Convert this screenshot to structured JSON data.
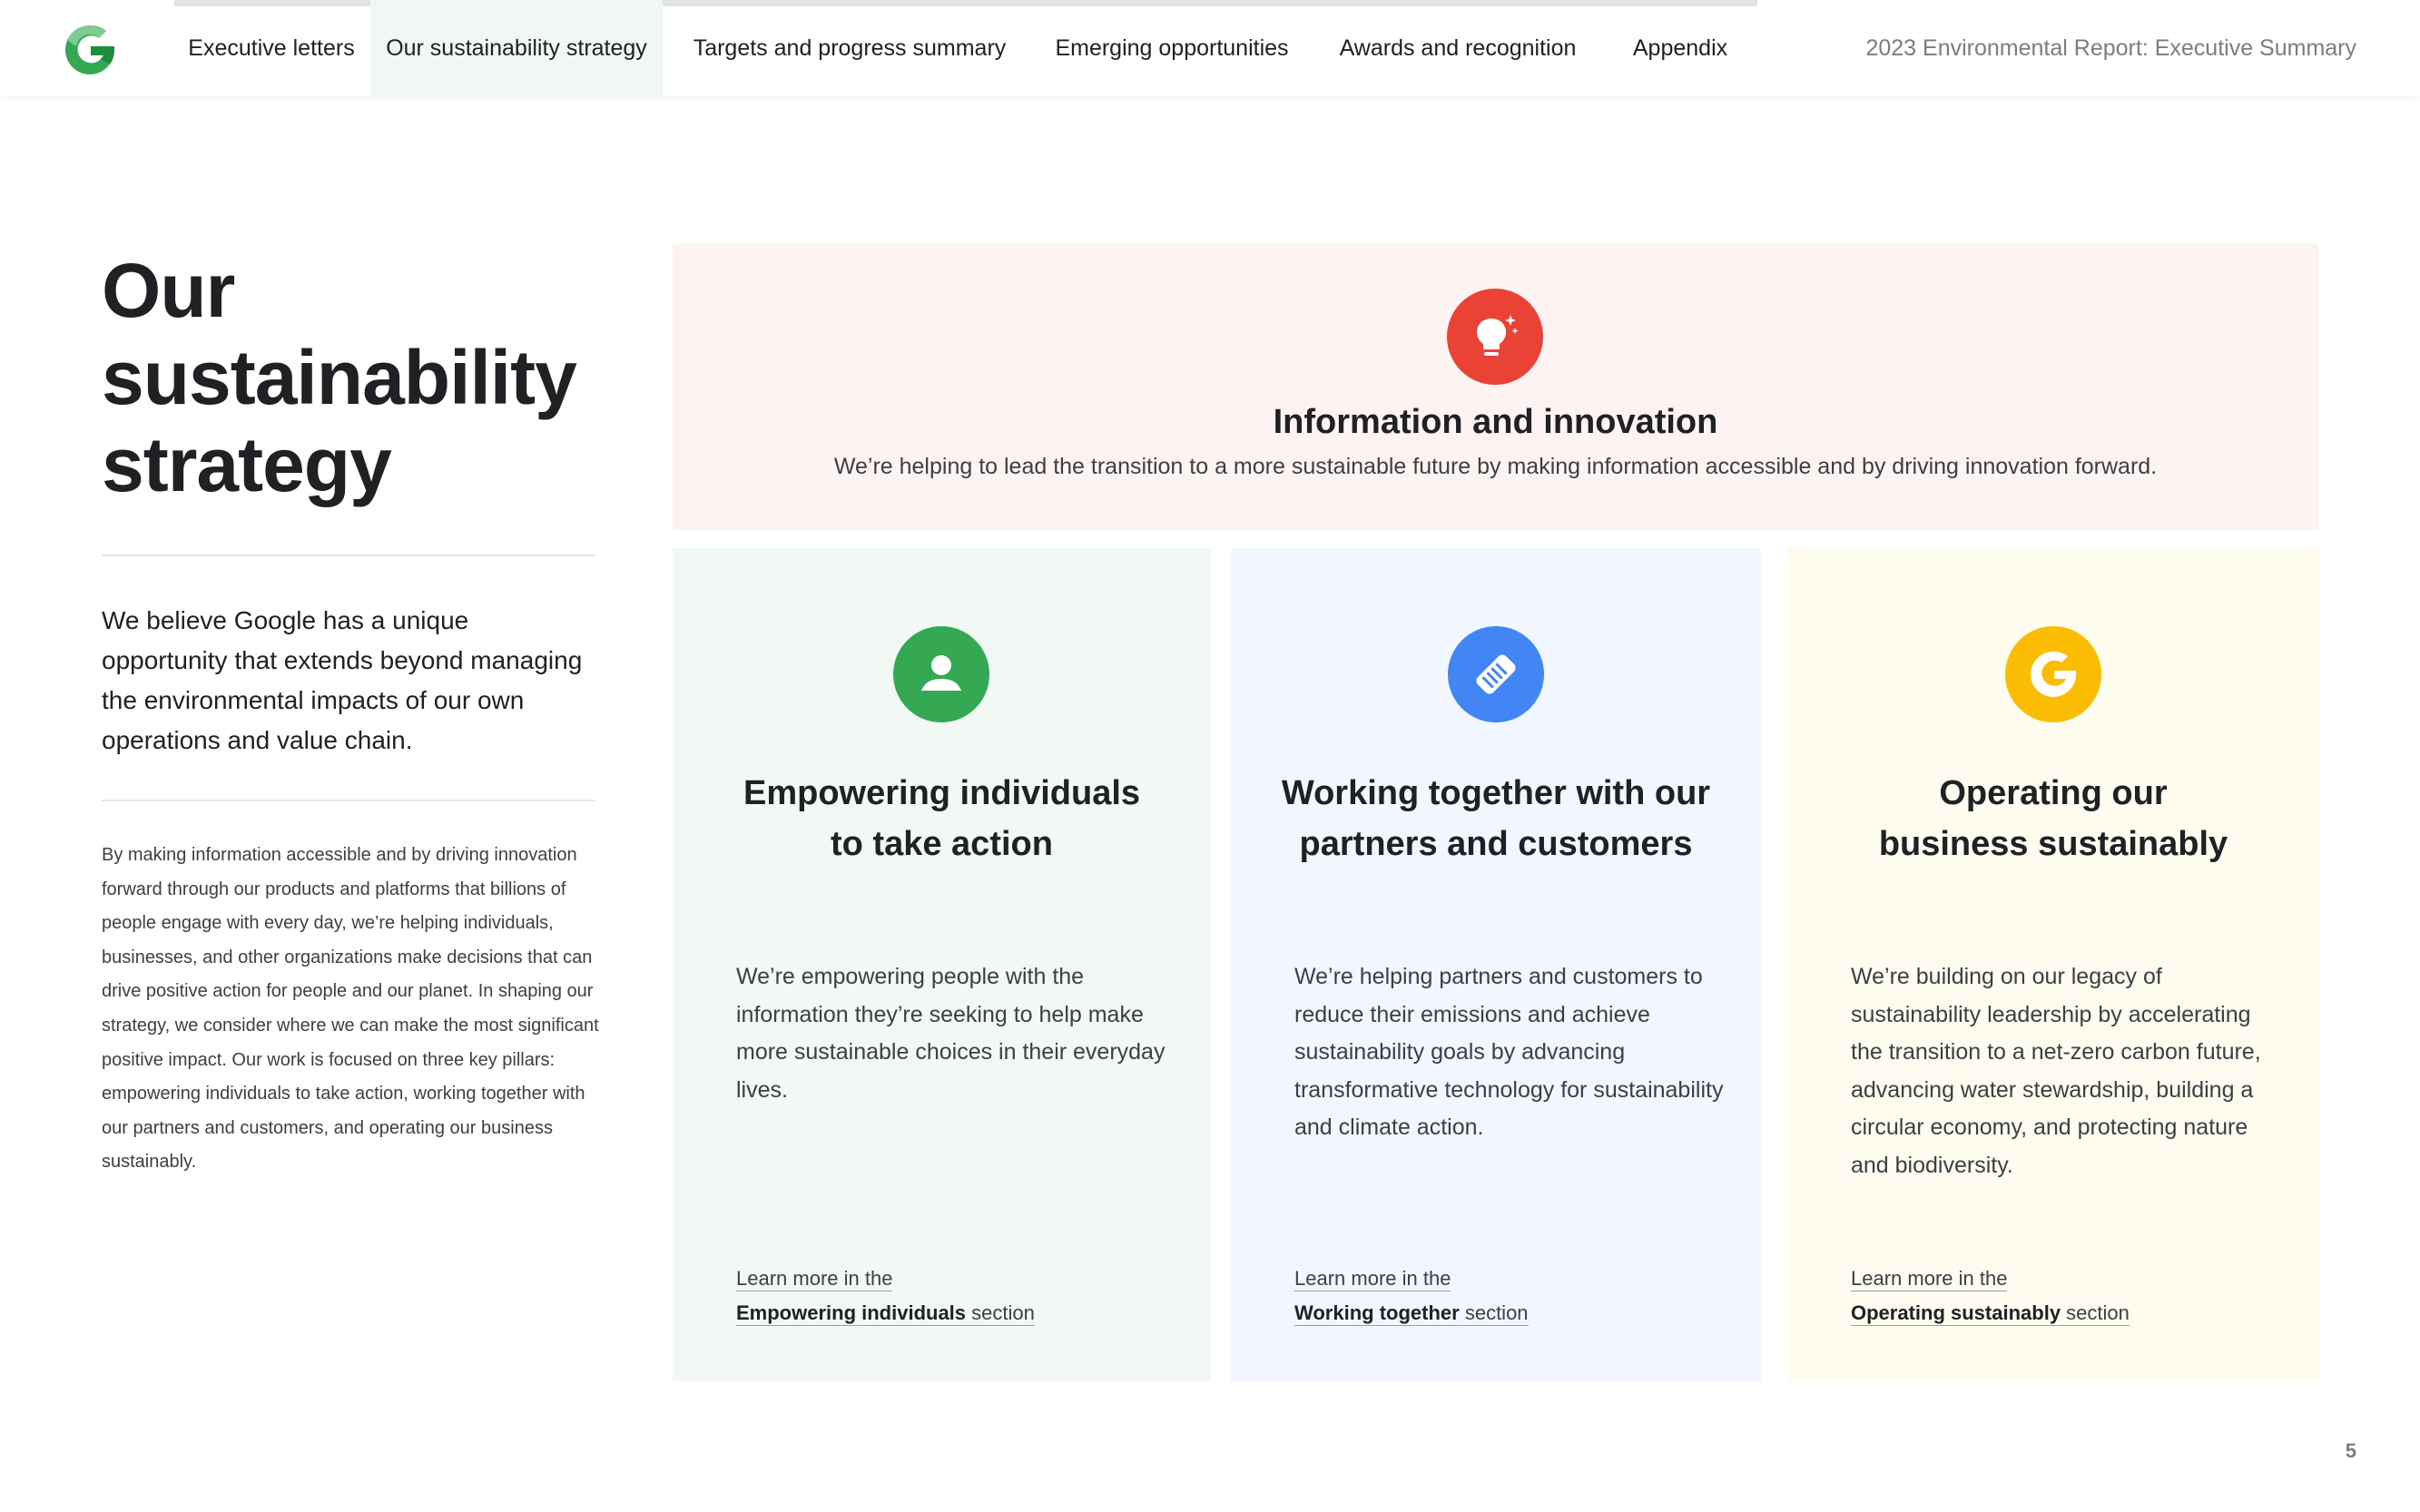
{
  "header": {
    "nav": [
      {
        "label": "Executive letters"
      },
      {
        "label": "Our sustainability strategy"
      },
      {
        "label": "Targets and progress summary"
      },
      {
        "label": "Emerging opportunities"
      },
      {
        "label": "Awards and recognition"
      },
      {
        "label": "Appendix"
      }
    ],
    "doc_title": "2023 Environmental Report: Executive Summary"
  },
  "colors": {
    "green": "#34a853",
    "red": "#ea4335",
    "blue": "#4285f4",
    "yellow": "#fbbc04"
  },
  "left": {
    "title": "Our sustainability strategy",
    "lede": "We believe Google has a unique opportunity that extends beyond managing the environmental impacts of our own operations and value chain.",
    "body": "By making information accessible and by driving innovation forward through our products and platforms that billions of people engage with every day, we’re helping individuals, businesses, and other organizations make decisions that can drive positive action for people and our planet. In shaping our strategy, we consider where we can make the most significant positive impact. Our work is focused on three key pillars: empowering individuals to take action, working together with our partners and customers, and operating our business sustainably."
  },
  "top_card": {
    "icon": "lightbulb-icon",
    "heading": "Information and innovation",
    "description": "We’re helping to lead the transition to a more sustainable future by making information accessible and by driving innovation forward."
  },
  "pillars": [
    {
      "icon": "person-icon",
      "heading_line1": "Empowering individuals",
      "heading_line2": "to take action",
      "description": "We’re empowering people with the information they’re seeking to help make more sustainable choices in their everyday lives.",
      "link_prefix": "Learn more in the",
      "link_bold": "Empowering individuals",
      "link_suffix": " section"
    },
    {
      "icon": "handshake-icon",
      "heading_line1": "Working together with our",
      "heading_line2": "partners and customers",
      "description": "We’re helping partners and customers to reduce their emissions and achieve sustainability goals by advancing transformative technology for sustainability and climate action.",
      "link_prefix": "Learn more in the",
      "link_bold": "Working together",
      "link_suffix": " section"
    },
    {
      "icon": "google-g-icon",
      "heading_line1": "Operating our",
      "heading_line2": "business sustainably",
      "description": "We’re building on our legacy of sustainability leadership by accelerating the transition to a net-zero carbon future, advancing water stewardship, building a circular economy, and protecting nature and biodiversity.",
      "link_prefix": "Learn more in the",
      "link_bold": "Operating sustainably",
      "link_suffix": " section"
    }
  ],
  "page_number": "5"
}
